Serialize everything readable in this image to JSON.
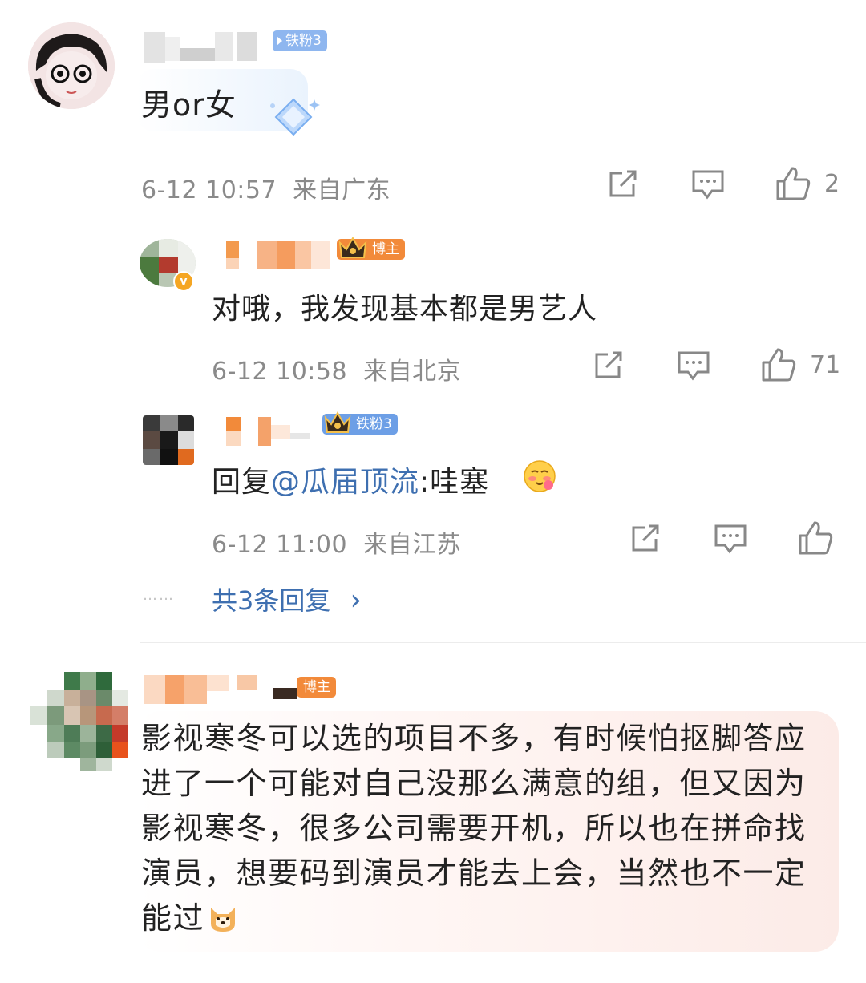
{
  "comments": [
    {
      "badge": "铁粉3",
      "text": "男or女",
      "time": "6-12 10:57",
      "location": "来自广东",
      "likes": "2"
    }
  ],
  "replies": [
    {
      "badge": "博主",
      "text": "对哦，我发现基本都是男艺人",
      "time": "6-12 10:58",
      "location": "来自北京",
      "likes": "71"
    },
    {
      "badge": "铁粉3",
      "reply_prefix": "回复",
      "mention": "@瓜届顶流",
      "text": ":哇塞",
      "time": "6-12 11:00",
      "location": "来自江苏",
      "likes": ""
    }
  ],
  "more_replies": {
    "dots": "……",
    "label": "共3条回复",
    "chevron": "›"
  },
  "comment2": {
    "badge": "博主",
    "text": "影视寒冬可以选的项目不多，有时候怕抠脚答应进了一个可能对自己没那么满意的组，但又因为影视寒冬，很多公司需要开机，所以也在拼命找演员，想要码到演员才能去上会，当然也不一定能过"
  },
  "icons": [
    "share-icon",
    "comment-icon",
    "like-icon",
    "blush-emoji-icon",
    "dog-emoji-icon",
    "fan-badge-icon",
    "blogger-crown-icon",
    "verified-v-icon"
  ],
  "colors": {
    "accent_blue": "#3e6fb0",
    "badge_blue": "#6d9fe6",
    "badge_orange": "#f28a3a",
    "meta_gray": "#8a8a8a"
  }
}
